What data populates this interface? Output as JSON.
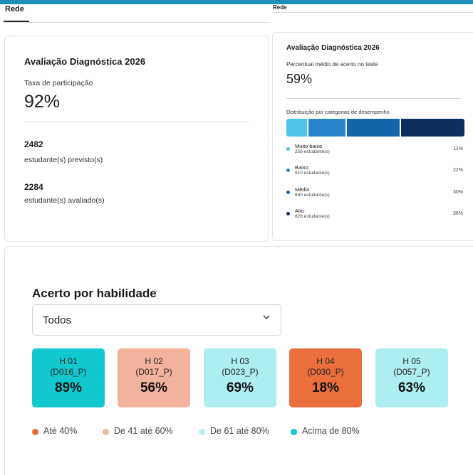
{
  "tabs": {
    "left_label": "Rede",
    "right_label": "Rede"
  },
  "participation_card": {
    "title": "Avaliação Diagnóstica 2026",
    "rate_label": "Taxa de participação",
    "rate_value": "92%",
    "expected_count": "2482",
    "expected_label": "estudante(s) previsto(s)",
    "evaluated_count": "2284",
    "evaluated_label": "estudante(s) avaliado(s)"
  },
  "performance_card": {
    "title": "Avaliação Diagnóstica 2026",
    "avg_label": "Percentual médio de acerto no teste",
    "avg_value": "59%",
    "distribution_title": "Distribuição por categorias de desempenho",
    "categories": [
      {
        "name": "Muito baixo",
        "count": "256 estudante(s)",
        "pct": "11%",
        "color": "#4fc3ea"
      },
      {
        "name": "Baixo",
        "count": "510 estudante(s)",
        "pct": "22%",
        "color": "#2a86cc"
      },
      {
        "name": "Médio",
        "count": "690 estudante(s)",
        "pct": "30%",
        "color": "#1565a9"
      },
      {
        "name": "Alto",
        "count": "828 estudante(s)",
        "pct": "36%",
        "color": "#0c2e5e"
      }
    ]
  },
  "skills_card": {
    "title": "Acerto por habilidade",
    "filter_value": "Todos",
    "filter_icon": "chevron-down-icon",
    "skills": [
      {
        "code": "H 01",
        "descriptor": "(D016_P)",
        "pct": "89%",
        "color": "#12c8cf"
      },
      {
        "code": "H 02",
        "descriptor": "(D017_P)",
        "pct": "56%",
        "color": "#f2b29b"
      },
      {
        "code": "H 03",
        "descriptor": "(D023_P)",
        "pct": "69%",
        "color": "#adeff0"
      },
      {
        "code": "H 04",
        "descriptor": "(D030_P)",
        "pct": "18%",
        "color": "#ea6f3d"
      },
      {
        "code": "H 05",
        "descriptor": "(D057_P)",
        "pct": "63%",
        "color": "#adeff0"
      }
    ],
    "legend": [
      {
        "label": "Até 40%",
        "color": "#e66a3a"
      },
      {
        "label": "De 41 até 60%",
        "color": "#f4b39e"
      },
      {
        "label": "De 61 até 80%",
        "color": "#bdeff6"
      },
      {
        "label": "Acima de 80%",
        "color": "#12c6d3"
      }
    ]
  }
}
